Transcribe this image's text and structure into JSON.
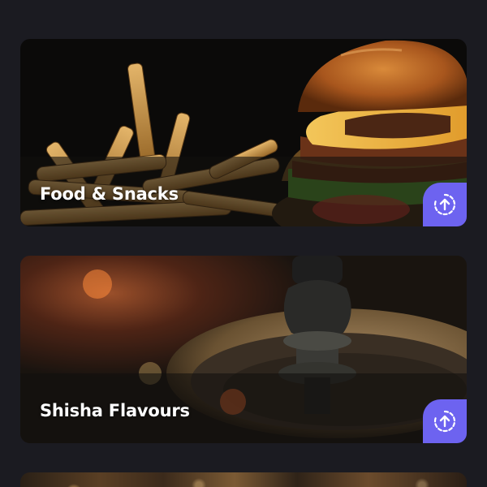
{
  "categories": [
    {
      "title": "Food & Snacks",
      "action_icon": "upload-circle-icon",
      "accent": "#6d63f0"
    },
    {
      "title": "Shisha Flavours",
      "action_icon": "upload-circle-icon",
      "accent": "#6d63f0"
    }
  ],
  "colors": {
    "background": "#1b1b21",
    "accent": "#6d63f0",
    "title_text": "#ffffff"
  }
}
